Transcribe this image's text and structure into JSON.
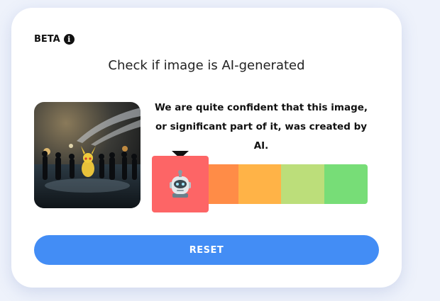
{
  "header": {
    "beta_label": "BETA",
    "info_icon": "info-icon"
  },
  "title": "Check if image is AI-generated",
  "result": {
    "message": "We are quite confident that this image, or significant part of it, was created by AI.",
    "active_level": 0,
    "indicator_icon": "robot-icon"
  },
  "scale_colors": [
    "#fd6566",
    "#ff8c47",
    "#ffb347",
    "#bcde7a",
    "#77dd77"
  ],
  "actions": {
    "reset_label": "RESET"
  },
  "colors": {
    "accent": "#438df5",
    "card": "#ffffff",
    "background": "#eef2fb"
  }
}
